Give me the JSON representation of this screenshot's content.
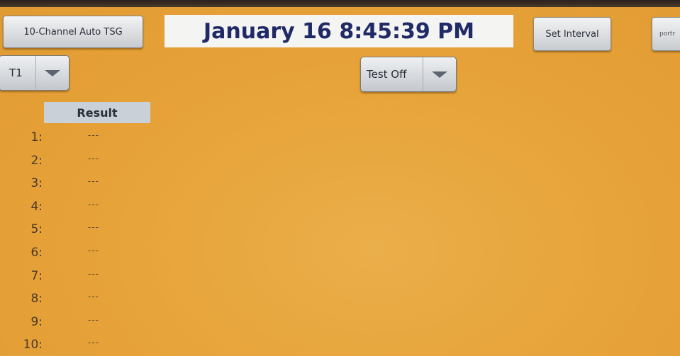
{
  "header": {
    "channel_button": "10-Channel Auto TSG",
    "datetime": "January 16 8:45:39 PM",
    "interval_button": "Set Interval",
    "portrait_button": "portr"
  },
  "controls": {
    "channel_select": "T1",
    "test_select": "Test Off"
  },
  "table": {
    "header": "Result",
    "rows": [
      {
        "label": "1:",
        "result": "---"
      },
      {
        "label": "2:",
        "result": "---"
      },
      {
        "label": "3:",
        "result": "---"
      },
      {
        "label": "4:",
        "result": "---"
      },
      {
        "label": "5:",
        "result": "---"
      },
      {
        "label": "6:",
        "result": "---"
      },
      {
        "label": "7:",
        "result": "---"
      },
      {
        "label": "8:",
        "result": "---"
      },
      {
        "label": "9:",
        "result": "---"
      },
      {
        "label": "10:",
        "result": "---"
      }
    ]
  },
  "icons": {
    "dropdown": "chevron-down-icon"
  },
  "colors": {
    "background": "#e8a43c",
    "datetime_text": "#202a66",
    "button_face": "#dcdee1",
    "header_cell": "#c9d0d8"
  }
}
